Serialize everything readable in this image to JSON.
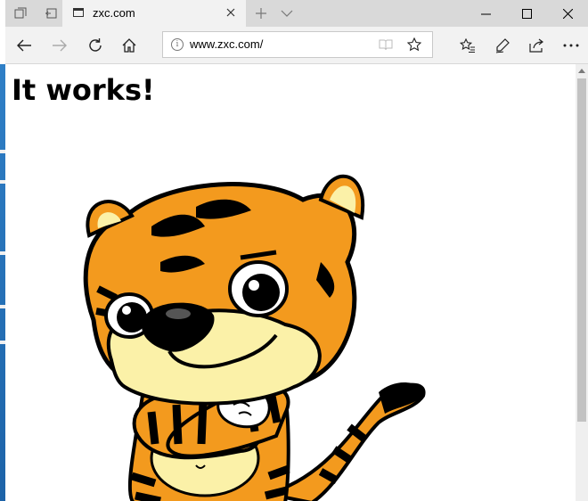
{
  "tab": {
    "title": "zxc.com"
  },
  "address_bar": {
    "url": "www.zxc.com/",
    "info_glyph": "i"
  },
  "page": {
    "heading": "It works!"
  },
  "colors": {
    "tiger_orange": "#f39a1e",
    "tiger_cream": "#fbf1a8",
    "chrome_light": "#f2f2f2",
    "chrome_dark": "#d9d9d9"
  },
  "icons": {
    "tab_actions": [
      "tabs-aside-icon",
      "set-tabs-aside-icon"
    ],
    "nav": [
      "back-icon",
      "forward-icon",
      "refresh-icon",
      "home-icon"
    ],
    "address": [
      "reading-view-icon",
      "favorite-star-icon"
    ],
    "right_tools": [
      "favorites-hub-icon",
      "web-note-icon",
      "share-icon",
      "more-icon"
    ],
    "window": [
      "minimize-icon",
      "maximize-icon",
      "close-window-icon"
    ]
  }
}
